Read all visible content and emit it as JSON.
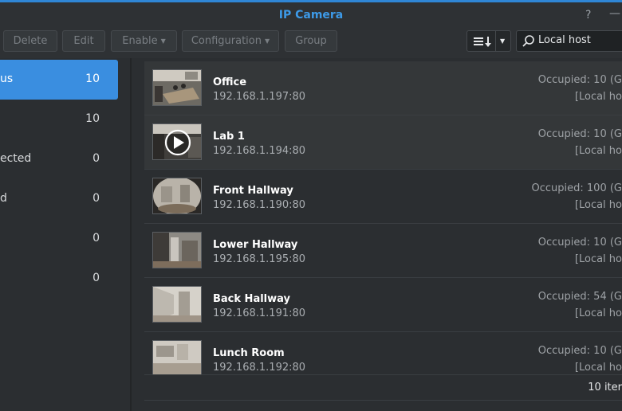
{
  "window": {
    "title": "IP Camera"
  },
  "toolbar": {
    "delete_label": "Delete",
    "edit_label": "Edit",
    "enable_label": "Enable",
    "configuration_label": "Configuration",
    "group_label": "Group"
  },
  "search": {
    "value": "Local host"
  },
  "sidebar": {
    "items": [
      {
        "label": "us",
        "count": "10",
        "active": true
      },
      {
        "label": "",
        "count": "10"
      },
      {
        "label": "ected",
        "count": "0"
      },
      {
        "label": "d",
        "count": "0"
      },
      {
        "label": "",
        "count": "0"
      },
      {
        "label": "",
        "count": "0"
      }
    ]
  },
  "cameras": [
    {
      "name": "Office",
      "ip": "192.168.1.197:80",
      "occupied": "Occupied: 10 (G",
      "host": "[Local ho"
    },
    {
      "name": "Lab 1",
      "ip": "192.168.1.194:80",
      "occupied": "Occupied: 10 (G",
      "host": "[Local ho"
    },
    {
      "name": "Front Hallway",
      "ip": "192.168.1.190:80",
      "occupied": "Occupied: 100 (G",
      "host": "[Local ho"
    },
    {
      "name": "Lower Hallway",
      "ip": "192.168.1.195:80",
      "occupied": "Occupied: 10 (G",
      "host": "[Local ho"
    },
    {
      "name": "Back Hallway",
      "ip": "192.168.1.191:80",
      "occupied": "Occupied: 54 (G",
      "host": "[Local ho"
    },
    {
      "name": "Lunch Room",
      "ip": "192.168.1.192:80",
      "occupied": "Occupied: 10 (G",
      "host": "[Local ho"
    }
  ],
  "footer": {
    "count_text": "10 iter"
  },
  "colors": {
    "accent": "#3a8ee0",
    "title": "#3d9ae8"
  }
}
